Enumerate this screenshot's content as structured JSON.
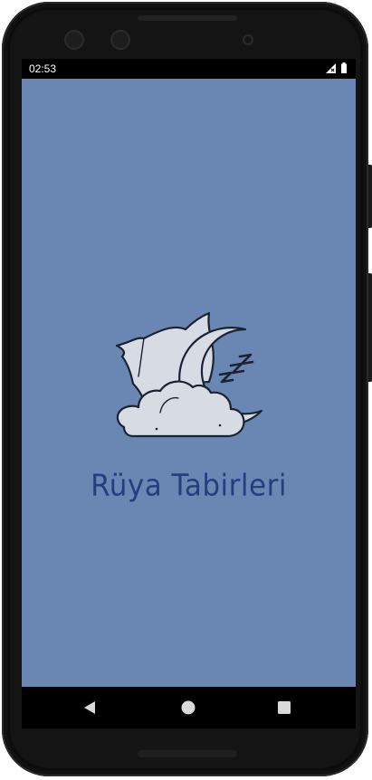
{
  "status_bar": {
    "time": "02:53",
    "signal_icon": "signal-icon",
    "battery_icon": "battery-icon"
  },
  "app": {
    "title": "Rüya Tabirleri",
    "background_color": "#6987b2",
    "title_color": "#263e80",
    "logo_icon": "sleeping-moon-pillow-cloud-icon"
  },
  "nav_bar": {
    "back_icon": "back-triangle-icon",
    "home_icon": "home-circle-icon",
    "recent_icon": "recent-apps-square-icon"
  }
}
